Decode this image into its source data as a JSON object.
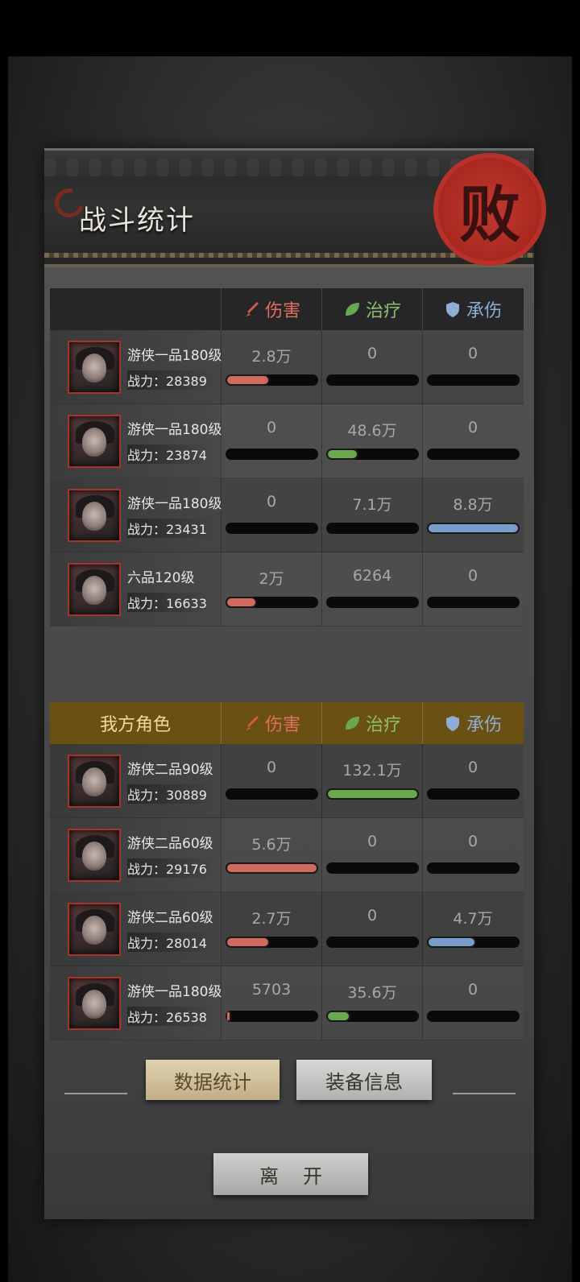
{
  "title": "战斗统计",
  "seal_char": "败",
  "columns": {
    "damage": "伤害",
    "heal": "治疗",
    "tank": "承伤"
  },
  "enemy_table": {
    "header_label": "",
    "rows": [
      {
        "name": "游侠一品180级",
        "power": "战力：28389",
        "damage": "2.8万",
        "heal": "0",
        "tank": "0",
        "damage_fill": 0.48,
        "heal_fill": 0,
        "tank_fill": 0
      },
      {
        "name": "游侠一品180级",
        "power": "战力：23874",
        "damage": "0",
        "heal": "48.6万",
        "tank": "0",
        "damage_fill": 0,
        "heal_fill": 0.35,
        "tank_fill": 0
      },
      {
        "name": "游侠一品180级",
        "power": "战力：23431",
        "damage": "0",
        "heal": "7.1万",
        "tank": "8.8万",
        "damage_fill": 0,
        "heal_fill": 0,
        "tank_fill": 1.0
      },
      {
        "name": "六品120级",
        "power": "战力：16633",
        "damage": "2万",
        "heal": "6264",
        "tank": "0",
        "damage_fill": 0.34,
        "heal_fill": 0,
        "tank_fill": 0
      }
    ]
  },
  "ally_table": {
    "header_label": "我方角色",
    "rows": [
      {
        "name": "游侠二品90级",
        "power": "战力：30889",
        "damage": "0",
        "heal": "132.1万",
        "tank": "0",
        "damage_fill": 0,
        "heal_fill": 1.0,
        "tank_fill": 0
      },
      {
        "name": "游侠二品60级",
        "power": "战力：29176",
        "damage": "5.6万",
        "heal": "0",
        "tank": "0",
        "damage_fill": 1.0,
        "heal_fill": 0,
        "tank_fill": 0
      },
      {
        "name": "游侠二品60级",
        "power": "战力：28014",
        "damage": "2.7万",
        "heal": "0",
        "tank": "4.7万",
        "damage_fill": 0.48,
        "heal_fill": 0,
        "tank_fill": 0.53
      },
      {
        "name": "游侠一品180级",
        "power": "战力：26538",
        "damage": "5703",
        "heal": "35.6万",
        "tank": "0",
        "damage_fill": 0.06,
        "heal_fill": 0.26,
        "tank_fill": 0
      }
    ]
  },
  "buttons": {
    "stats": "数据统计",
    "equip": "装备信息",
    "leave": "离开"
  },
  "colors": {
    "damage": "#e0705e",
    "heal": "#8fbf6e",
    "tank": "#8eaed6",
    "seal": "#b8302a",
    "ally_header": "#6b5014"
  }
}
